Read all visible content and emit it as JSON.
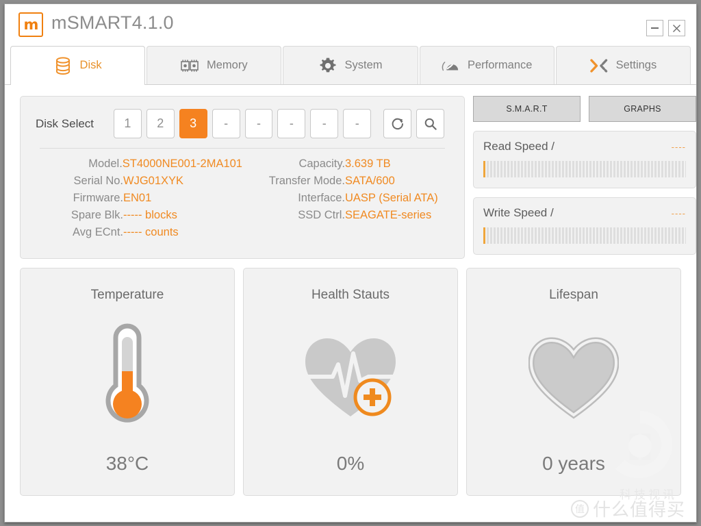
{
  "app": {
    "logo_glyph": "m",
    "title": "mSMART4.1.0",
    "window_controls": [
      {
        "name": "minimize",
        "label": "–"
      },
      {
        "name": "close",
        "label": "✕"
      }
    ]
  },
  "tabs": [
    {
      "label": "Disk",
      "icon": "disk-stack-icon",
      "active": true
    },
    {
      "label": "Memory",
      "icon": "memory-chip-icon",
      "active": false
    },
    {
      "label": "System",
      "icon": "gear-icon",
      "active": false
    },
    {
      "label": "Performance",
      "icon": "gauge-icon",
      "active": false
    },
    {
      "label": "Settings",
      "icon": "chevrons-icon",
      "active": false
    }
  ],
  "disk_select": {
    "label": "Disk Select",
    "slots": [
      {
        "label": "1",
        "selected": false
      },
      {
        "label": "2",
        "selected": false
      },
      {
        "label": "3",
        "selected": true
      },
      {
        "label": "-",
        "selected": false
      },
      {
        "label": "-",
        "selected": false
      },
      {
        "label": "-",
        "selected": false
      },
      {
        "label": "-",
        "selected": false
      },
      {
        "label": "-",
        "selected": false
      }
    ],
    "refresh_icon": "refresh-icon",
    "search_icon": "search-icon"
  },
  "disk_info": {
    "left": [
      {
        "key": "Model.",
        "value": "ST4000NE001-2MA101"
      },
      {
        "key": "Serial No.",
        "value": "WJG01XYK"
      },
      {
        "key": "Firmware.",
        "value": "EN01"
      },
      {
        "key": "Spare Blk.",
        "value": "----- blocks"
      },
      {
        "key": "Avg ECnt.",
        "value": "----- counts"
      }
    ],
    "right": [
      {
        "key": "",
        "value": ""
      },
      {
        "key": "Capacity.",
        "value": "3.639 TB"
      },
      {
        "key": "Transfer Mode.",
        "value": "SATA/600"
      },
      {
        "key": "Interface.",
        "value": "UASP (Serial ATA)"
      },
      {
        "key": "SSD Ctrl.",
        "value": "SEAGATE-series"
      }
    ]
  },
  "actions": {
    "smart_label": "S.M.A.R.T",
    "graphs_label": "GRAPHS"
  },
  "speeds": [
    {
      "label": "Read Speed /",
      "value": "----",
      "segments_total": 62,
      "segments_on": 1
    },
    {
      "label": "Write Speed /",
      "value": "----",
      "segments_total": 62,
      "segments_on": 1
    }
  ],
  "stats": [
    {
      "title": "Temperature",
      "value": "38°C",
      "icon": "thermometer-icon"
    },
    {
      "title": "Health Stauts",
      "value": "0%",
      "icon": "heart-pulse-plus-icon"
    },
    {
      "title": "Lifespan",
      "value": "0 years",
      "icon": "heart-outline-icon"
    }
  ],
  "watermarks": {
    "cn_text": "科技视讯",
    "smzdm_badge": "值",
    "smzdm_text": "什么值得买"
  },
  "colors": {
    "accent": "#f58220",
    "accent_text": "#f08a22",
    "tab_active_text": "#e8912a",
    "panel_bg": "#f2f2f2",
    "label_gray": "#8a8a8a"
  }
}
